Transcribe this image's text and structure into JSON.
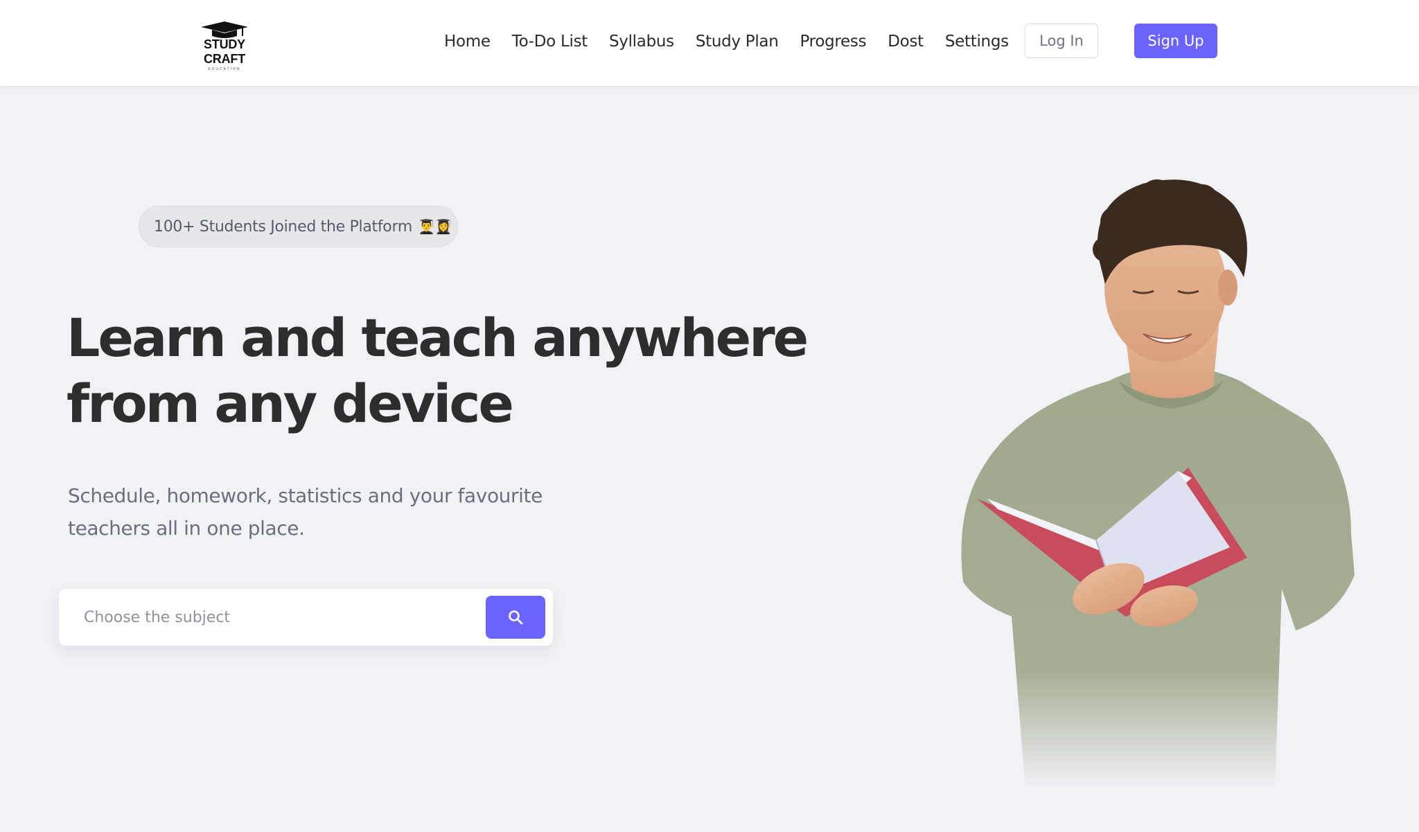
{
  "brand": {
    "name": "STUDY CRAFT",
    "tagline": "EDUCATION"
  },
  "nav": {
    "items": [
      {
        "label": "Home"
      },
      {
        "label": "To-Do List"
      },
      {
        "label": "Syllabus"
      },
      {
        "label": "Study Plan"
      },
      {
        "label": "Progress"
      },
      {
        "label": "Dost"
      },
      {
        "label": "Settings"
      }
    ],
    "login_label": "Log In",
    "signup_label": "Sign Up"
  },
  "hero": {
    "badge_text": "100+ Students Joined the Platform",
    "badge_emoji": "👨‍🎓👩‍🎓",
    "headline_line1": "Learn and teach anywhere",
    "headline_line2": "from any device",
    "subtext_line1": "Schedule, homework, statistics and your favourite",
    "subtext_line2": "teachers all in one place.",
    "search_placeholder": "Choose the subject",
    "search_icon": "search-icon"
  },
  "colors": {
    "accent": "#6c63ff",
    "background": "#f1f2f6",
    "header_bg": "#ffffff"
  }
}
